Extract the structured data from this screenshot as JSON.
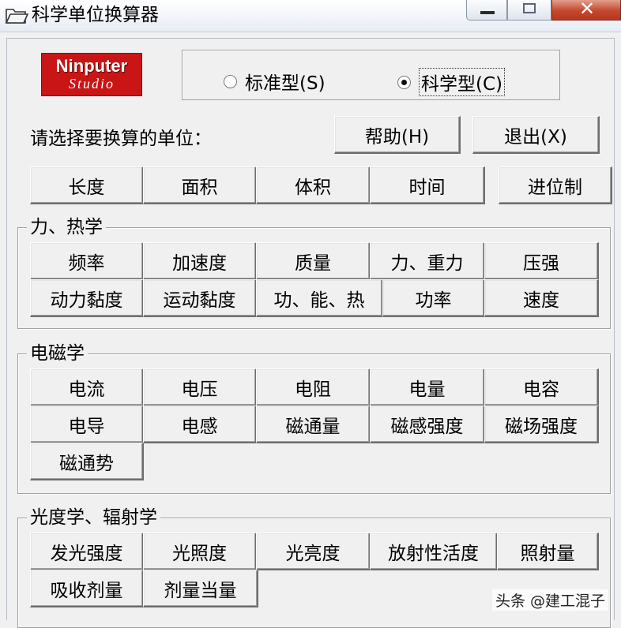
{
  "window": {
    "title": "科学单位换算器",
    "close_glyph": "✕"
  },
  "logo": {
    "main": "Ninputer",
    "sub": "Studio"
  },
  "mode": {
    "standard_label": "标准型(S)",
    "scientific_label": "科学型(C)",
    "selected": "scientific"
  },
  "prompt": "请选择要换算的单位：",
  "help_label": "帮助(H)",
  "exit_label": "退出(X)",
  "basic_units": [
    "长度",
    "面积",
    "体积",
    "时间"
  ],
  "radix_label": "进位制",
  "groups": {
    "mechanics": {
      "title": "力、热学",
      "items": [
        "频率",
        "加速度",
        "质量",
        "力、重力",
        "压强",
        "动力黏度",
        "运动黏度",
        "功、能、热",
        "功率",
        "速度"
      ]
    },
    "electromagnetism": {
      "title": "电磁学",
      "items": [
        "电流",
        "电压",
        "电阻",
        "电量",
        "电容",
        "电导",
        "电感",
        "磁通量",
        "磁感强度",
        "磁场强度",
        "磁通势"
      ]
    },
    "optics": {
      "title": "光度学、辐射学",
      "items": [
        "发光强度",
        "光照度",
        "光亮度",
        "放射性活度",
        "照射量",
        "吸收剂量",
        "剂量当量"
      ]
    }
  },
  "watermark": "头条 @建工混子"
}
